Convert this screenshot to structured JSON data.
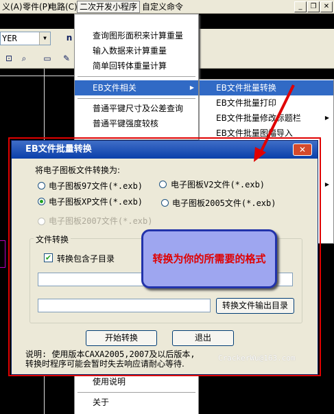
{
  "menubar": {
    "items": [
      "义(A)",
      "零件(P)",
      "电路(C)",
      "二次开发小程序",
      "自定义命令"
    ],
    "active_index": 3
  },
  "toolbar": {
    "layer_value": "YER",
    "icons": [
      "snap-icon",
      "zoom-icon",
      "measure-icon",
      "pencil-icon",
      "n-icon"
    ]
  },
  "dropdown": {
    "items": [
      {
        "label": "查询图形面积来计算重量",
        "has_submenu": false
      },
      {
        "label": "输入数据来计算重量",
        "has_submenu": false
      },
      {
        "label": "简单回转体重量计算",
        "has_submenu": false
      },
      {
        "label": "EB文件相关",
        "has_submenu": true,
        "selected": true
      },
      {
        "label": "普通平键尺寸及公差查询",
        "has_submenu": false
      },
      {
        "label": "普通平键强度较核",
        "has_submenu": false
      }
    ],
    "lower_items": [
      "使用说明",
      "关于"
    ]
  },
  "submenu": {
    "items": [
      {
        "label": "EB文件批量转换",
        "selected": true
      },
      {
        "label": "EB文件批量打印",
        "selected": false
      },
      {
        "label": "EB文件批量修改标题栏",
        "selected": false,
        "has_submenu": true
      },
      {
        "label": "EB文件批量图幅导入",
        "selected": false
      }
    ]
  },
  "dialog": {
    "title": "EB文件批量转换",
    "convert_to_label": "将电子图板文件转换为:",
    "options": [
      {
        "label": "电子图板97文件(*.exb)",
        "checked": false,
        "disabled": false
      },
      {
        "label": "电子图板V2文件(*.exb)",
        "checked": false,
        "disabled": false
      },
      {
        "label": "电子图板XP文件(*.exb)",
        "checked": true,
        "disabled": false
      },
      {
        "label": "电子图板2005文件(*.exb)",
        "checked": false,
        "disabled": false
      },
      {
        "label": "电子图板2007文件(*.exb)",
        "checked": false,
        "disabled": true
      }
    ],
    "group_label": "文件转换",
    "include_subdirs_label": "转换包含子目录",
    "include_subdirs_checked": true,
    "source_path": "",
    "output_path": "",
    "output_dir_button": "转换文件输出目录",
    "start_button": "开始转换",
    "exit_button": "退出",
    "note_line1": "说明: 使用版本CAXA2005,2007及以后版本,",
    "note_line2": "转换时程序可能会暂时失去响应请耐心等待."
  },
  "annotation": {
    "callout_text": "转换为你的所需要的格式",
    "watermark": "CrackerWu@163.com",
    "highlight_color": "#e00000"
  }
}
